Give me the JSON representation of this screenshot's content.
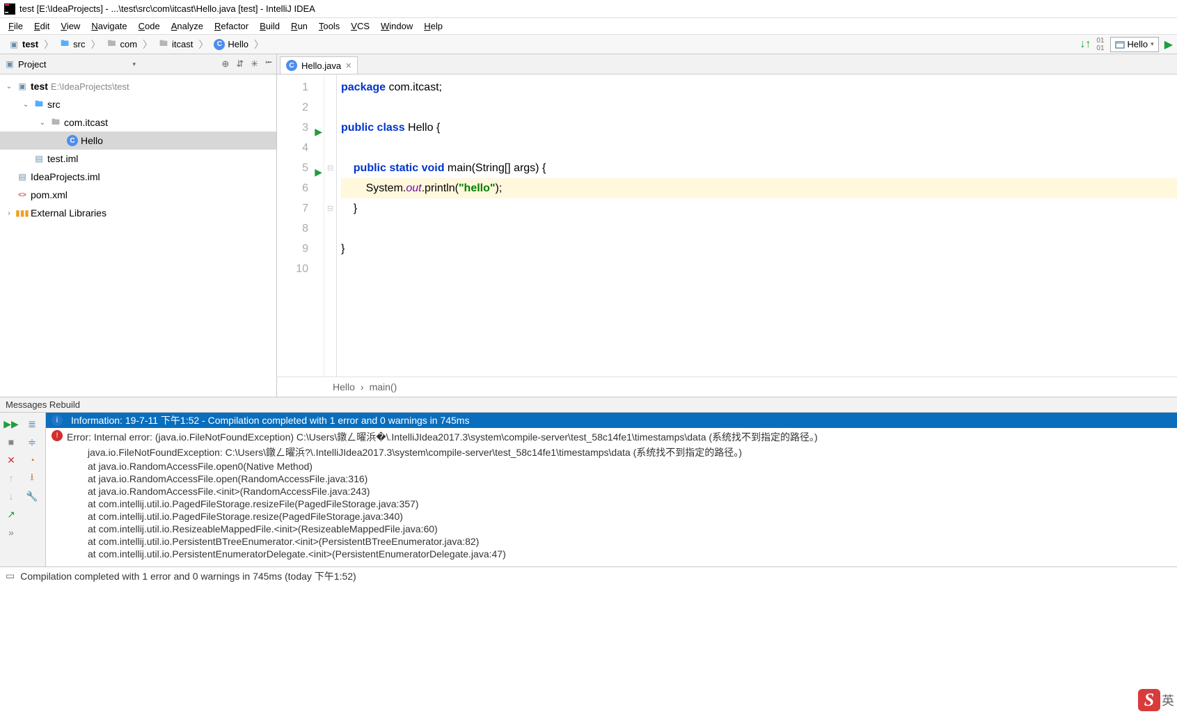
{
  "titlebar": {
    "text": "test [E:\\IdeaProjects] - ...\\test\\src\\com\\itcast\\Hello.java [test] - IntelliJ IDEA"
  },
  "menu": {
    "items": [
      "File",
      "Edit",
      "View",
      "Navigate",
      "Code",
      "Analyze",
      "Refactor",
      "Build",
      "Run",
      "Tools",
      "VCS",
      "Window",
      "Help"
    ]
  },
  "breadcrumbs": {
    "items": [
      {
        "icon": "module",
        "label": "test"
      },
      {
        "icon": "folder",
        "label": "src"
      },
      {
        "icon": "folder-dim",
        "label": "com"
      },
      {
        "icon": "folder-dim",
        "label": "itcast"
      },
      {
        "icon": "class",
        "label": "Hello"
      }
    ]
  },
  "run_config_label": "Hello",
  "project_panel": {
    "title": "Project",
    "tree": [
      {
        "depth": 0,
        "arrow": "v",
        "icon": "module",
        "label": "test",
        "suffix": "E:\\IdeaProjects\\test"
      },
      {
        "depth": 1,
        "arrow": "v",
        "icon": "folder",
        "label": "src"
      },
      {
        "depth": 2,
        "arrow": "v",
        "icon": "folder-dim",
        "label": "com.itcast"
      },
      {
        "depth": 3,
        "arrow": "",
        "icon": "class",
        "label": "Hello",
        "selected": true
      },
      {
        "depth": 1,
        "arrow": "",
        "icon": "file",
        "label": "test.iml"
      },
      {
        "depth": 0,
        "arrow": "",
        "icon": "file",
        "label": "IdeaProjects.iml"
      },
      {
        "depth": 0,
        "arrow": "",
        "icon": "xml",
        "label": "pom.xml"
      },
      {
        "depth": 0,
        "arrow": ">",
        "icon": "lib",
        "label": "External Libraries"
      }
    ]
  },
  "editor": {
    "tab_label": "Hello.java",
    "lines": [
      {
        "n": 1,
        "html": "<span class='kw'>package</span> com.itcast;"
      },
      {
        "n": 2,
        "html": ""
      },
      {
        "n": 3,
        "run": true,
        "html": "<span class='kw'>public class</span> Hello {"
      },
      {
        "n": 4,
        "html": ""
      },
      {
        "n": 5,
        "run": true,
        "fold": "-",
        "html": "    <span class='kw'>public static void</span> main(String[] args) {"
      },
      {
        "n": 6,
        "hl": true,
        "html": "        System.<span class='static-field'>out</span>.println(<span class='str'>\"hello\"</span>);"
      },
      {
        "n": 7,
        "fold": "-",
        "html": "    }"
      },
      {
        "n": 8,
        "html": ""
      },
      {
        "n": 9,
        "html": "}"
      },
      {
        "n": 10,
        "html": ""
      }
    ],
    "crumb_path": [
      "Hello",
      "main()"
    ]
  },
  "messages": {
    "title": "Messages Rebuild",
    "info": "Information: 19-7-11 下午1:52 - Compilation completed with 1 error and 0 warnings in 745ms",
    "error_head": "Error: Internal error: (java.io.FileNotFoundException) C:\\Users\\鐓ㄥ曜浜�\\.IntelliJIdea2017.3\\system\\compile-server\\test_58c14fe1\\timestamps\\data (系统找不到指定的路径。)",
    "trace": [
      "java.io.FileNotFoundException: C:\\Users\\鐓ㄥ曜浜?\\.IntelliJIdea2017.3\\system\\compile-server\\test_58c14fe1\\timestamps\\data (系统找不到指定的路径。)",
      "at java.io.RandomAccessFile.open0(Native Method)",
      "at java.io.RandomAccessFile.open(RandomAccessFile.java:316)",
      "at java.io.RandomAccessFile.<init>(RandomAccessFile.java:243)",
      "at com.intellij.util.io.PagedFileStorage.resizeFile(PagedFileStorage.java:357)",
      "at com.intellij.util.io.PagedFileStorage.resize(PagedFileStorage.java:340)",
      "at com.intellij.util.io.ResizeableMappedFile.<init>(ResizeableMappedFile.java:60)",
      "at com.intellij.util.io.PersistentBTreeEnumerator.<init>(PersistentBTreeEnumerator.java:82)",
      "at com.intellij.util.io.PersistentEnumeratorDelegate.<init>(PersistentEnumeratorDelegate.java:47)"
    ]
  },
  "status": {
    "text": "Compilation completed with 1 error and 0 warnings in 745ms (today 下午1:52)"
  },
  "ime_lang": "英"
}
